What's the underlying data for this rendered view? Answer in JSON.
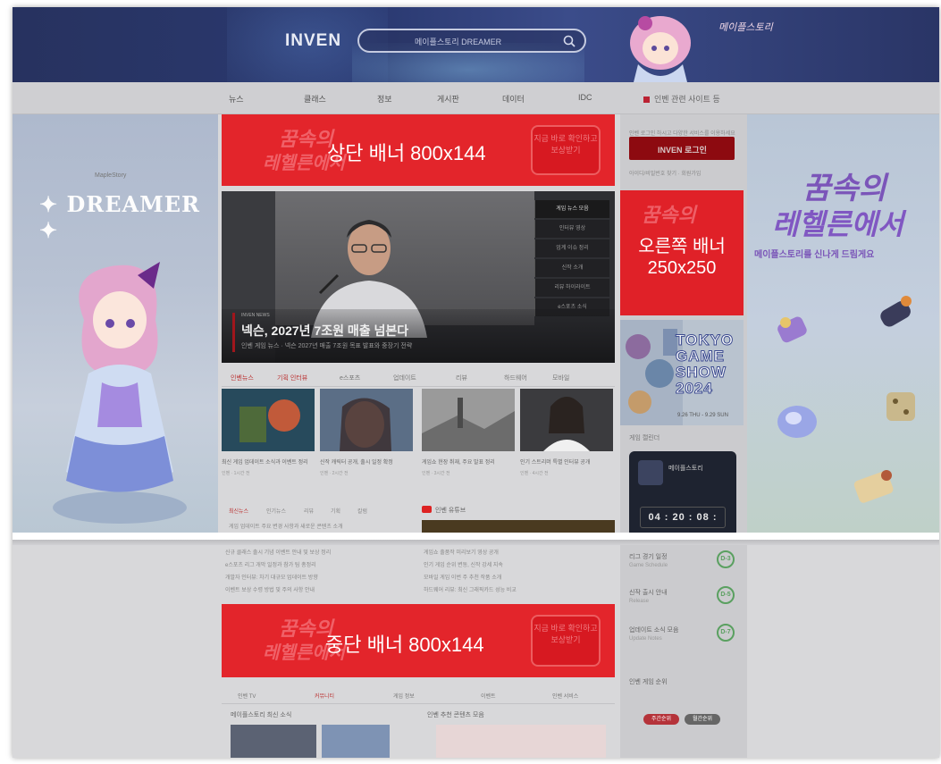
{
  "header": {
    "logo": "INVEN",
    "search_placeholder": "메이플스토리 DREAMER",
    "corner_text": "메이플스토리"
  },
  "nav": {
    "items": [
      "뉴스",
      "클래스",
      "정보",
      "게시판",
      "데이터",
      "IDC"
    ],
    "bookmark": "인벤 관련 사이트 등"
  },
  "left_ad": {
    "brand": "MapleStory",
    "title": "DREAMER"
  },
  "right_ad": {
    "line1": "꿈속의",
    "line2": "레헬른에서",
    "line3": "메이플스토리를 신나게 드림게요"
  },
  "banners": {
    "top": {
      "label": "상단 배너 800x144",
      "faded_1": "꿈속의",
      "faded_2": "레헬른에서",
      "box": "지금 바로 확인하고 보상받기"
    },
    "middle": {
      "label": "중단 배너 800x144",
      "faded_1": "꿈속의",
      "faded_2": "레헬른에서",
      "box": "지금 바로 확인하고 보상받기"
    }
  },
  "sidebar": {
    "login_hint": "인벤 로그인 하시고 다양한 서비스를 이용하세요",
    "login_button": "INVEN 로그인",
    "login_sub": "아이디/비밀번호 찾기 · 회원가입",
    "right_banner_line1": "오른쪽 배너",
    "right_banner_line2": "250x250",
    "tgs_text": "TOKYO GAME SHOW 2024",
    "tgs_date": "9.26 THU - 9.29 SUN",
    "schedule_head": "게임 캘린더",
    "countdown_name": "메이플스토리",
    "countdown_time": "04 : 20 : 08 : 30",
    "rows": [
      {
        "t1": "리그 경기 일정",
        "t2": "Game Schedule",
        "badge": "D-3"
      },
      {
        "t1": "신작 출시 안내",
        "t2": "Release",
        "badge": "D-5"
      },
      {
        "t1": "업데이트 소식 모음",
        "t2": "Update Notes",
        "badge": "D-7"
      }
    ],
    "rank_head": "인벤 게임 순위",
    "pill_1": "주간순위",
    "pill_2": "월간순위"
  },
  "video": {
    "headline": "넥슨, 2027년 7조원 매출 넘본다",
    "subline": "인벤 게임 뉴스 · 넥슨 2027년 매출 7조원 목표 발표와 중장기 전략",
    "tag": "INVEN NEWS",
    "playlist": [
      "게임 뉴스 모음",
      "인터뷰 영상",
      "업계 이슈 정리",
      "신작 소개",
      "리뷰 하이라이트",
      "e스포츠 소식",
      "인벤 영상 채널"
    ]
  },
  "tabs": [
    "인벤뉴스",
    "기획 인터뷰",
    "e스포츠",
    "업데이트",
    "리뷰",
    "하드웨어",
    "모바일"
  ],
  "cards": [
    {
      "caption": "최신 게임 업데이트 소식과 이벤트 정리",
      "meta": "인벤 · 1시간 전"
    },
    {
      "caption": "신작 캐릭터 공개, 출시 일정 확정",
      "meta": "인벤 · 2시간 전"
    },
    {
      "caption": "게임쇼 현장 취재, 주요 발표 정리",
      "meta": "인벤 · 3시간 전"
    },
    {
      "caption": "인기 스트리머 특별 인터뷰 공개",
      "meta": "인벤 · 4시간 전"
    }
  ],
  "lower_tabs": [
    "최신뉴스",
    "인기뉴스",
    "리뷰",
    "기획",
    "칼럼"
  ],
  "news_left": [
    "게임 업데이트 주요 변경 사항과 새로운 콘텐츠 소개",
    "신규 클래스 출시 기념 이벤트 안내 및 보상 정리",
    "e스포츠 리그 개막 일정과 참가 팀 총정리",
    "개발자 인터뷰: 차기 대규모 업데이트 방향",
    "이벤트 보상 수령 방법 및 주의 사항 안내"
  ],
  "youtube_head": "인벤 유튜브",
  "news_right": [
    "게임쇼 출품작 미리보기 영상 공개",
    "인기 게임 순위 변동, 신작 강세 지속",
    "모바일 게임 이번 주 추천 작품 소개",
    "하드웨어 리뷰: 최신 그래픽카드 성능 비교"
  ],
  "bottom_tabs": [
    "인벤 TV",
    "커뮤니티",
    "게임 정보",
    "이벤트",
    "인벤 서비스"
  ],
  "bottom_titles": [
    "메이플스토리 최신 소식",
    "인벤 추천 콘텐츠 모음"
  ]
}
